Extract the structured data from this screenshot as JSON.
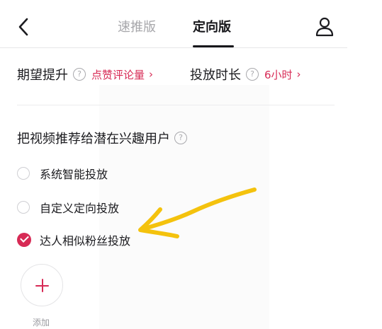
{
  "header": {
    "tabs": [
      {
        "label": "速推版",
        "active": false
      },
      {
        "label": "定向版",
        "active": true
      }
    ]
  },
  "options": {
    "boost": {
      "label": "期望提升",
      "value": "点赞评论量"
    },
    "duration": {
      "label": "投放时长",
      "value": "6小时"
    }
  },
  "targeting": {
    "title": "把视频推荐给潜在兴趣用户",
    "choices": [
      {
        "label": "系统智能投放",
        "selected": false
      },
      {
        "label": "自定义定向投放",
        "selected": false
      },
      {
        "label": "达人相似粉丝投放",
        "selected": true
      }
    ]
  },
  "add": {
    "label": "添加"
  },
  "icons": {
    "back": "chevron-left-icon",
    "user": "user-icon",
    "help": "question-circle-icon",
    "chevron": "chevron-right-icon",
    "plus": "plus-icon",
    "check": "check-icon"
  },
  "colors": {
    "accent": "#d72a55",
    "annotation": "#f4c20d",
    "text": "#1b1b1f",
    "muted": "#a7a7ab"
  }
}
